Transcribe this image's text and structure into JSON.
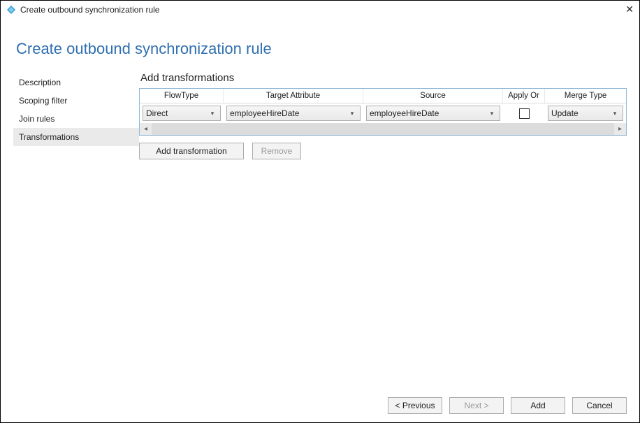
{
  "window": {
    "title": "Create outbound synchronization rule"
  },
  "heading": "Create outbound synchronization rule",
  "nav": {
    "items": [
      {
        "label": "Description"
      },
      {
        "label": "Scoping filter"
      },
      {
        "label": "Join rules"
      },
      {
        "label": "Transformations"
      }
    ],
    "selected_index": 3
  },
  "section_title": "Add transformations",
  "grid": {
    "headers": {
      "flow": "FlowType",
      "target": "Target Attribute",
      "source": "Source",
      "apply": "Apply Or",
      "merge": "Merge Type"
    },
    "rows": [
      {
        "flow": "Direct",
        "target": "employeeHireDate",
        "source": "employeeHireDate",
        "apply_once": false,
        "merge": "Update"
      }
    ]
  },
  "toolbar": {
    "add_label": "Add transformation",
    "remove_label": "Remove"
  },
  "footer": {
    "prev": "< Previous",
    "next": "Next >",
    "add": "Add",
    "cancel": "Cancel"
  }
}
